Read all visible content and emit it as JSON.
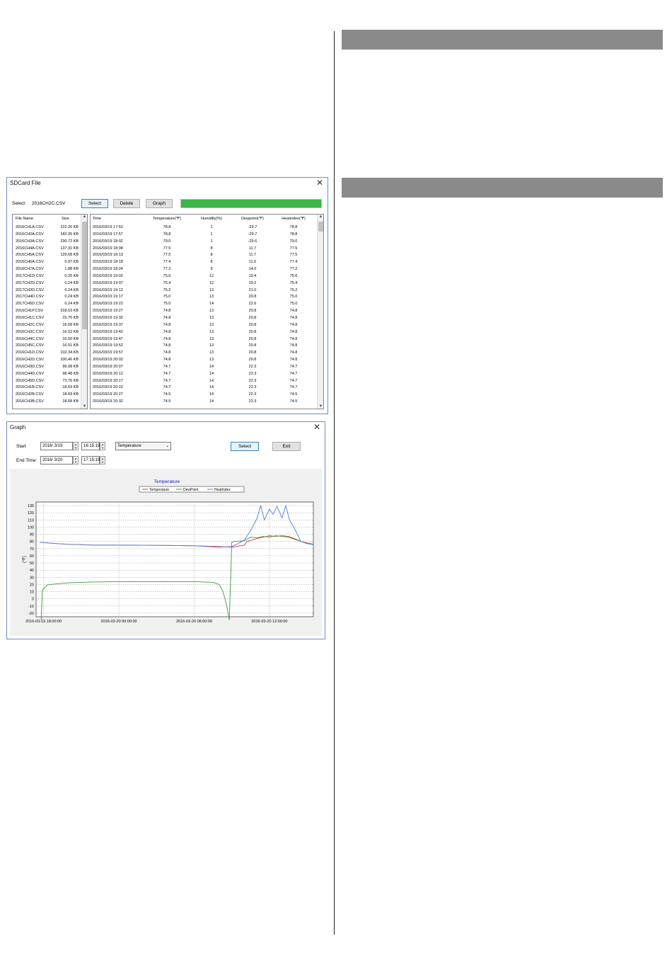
{
  "sdcard": {
    "title": "SDCard File",
    "select_label": "Select:",
    "selected_file": "2016CH2C.CSV",
    "buttons": {
      "select": "Select",
      "delete": "Delete",
      "graph": "Graph"
    },
    "progress": 1.0,
    "progress_color": "#3cb54a",
    "file_headers": [
      "File Name",
      "Size"
    ],
    "files": [
      [
        "2016CH1A.CSV",
        "222.26 KB"
      ],
      [
        "2016CH2A.CSV",
        "183.35 KB"
      ],
      [
        "2016CH3A.CSV",
        "230.72 KB"
      ],
      [
        "2016CH4A.CSV",
        "137.31 KB"
      ],
      [
        "2016CH5A.CSV",
        "129.68 KB"
      ],
      [
        "2016CH6A.CSV",
        "0.97 KB"
      ],
      [
        "2016CH7A.CSV",
        "1.88 KB"
      ],
      [
        "2017CH1D.CSV",
        "0.25 KB"
      ],
      [
        "2017CH2D.CSV",
        "0.24 KB"
      ],
      [
        "2017CH3D.CSV",
        "0.24 KB"
      ],
      [
        "2017CH4D.CSV",
        "0.24 KB"
      ],
      [
        "2017CH5D.CSV",
        "0.24 KB"
      ],
      [
        "2016CH1P.CSV",
        "318.53 KB"
      ],
      [
        "2016CH1C.CSV",
        "15.76 KB"
      ],
      [
        "2016CH2C.CSV",
        "16.58 KB"
      ],
      [
        "2016CH3C.CSV",
        "16.52 KB"
      ],
      [
        "2016CH4C.CSV",
        "16.50 KB"
      ],
      [
        "2016CH5C.CSV",
        "16.51 KB"
      ],
      [
        "2016CH1D.CSV",
        "102.34 KB"
      ],
      [
        "2016CH2D.CSV",
        "100.46 KB"
      ],
      [
        "2016CH3D.CSV",
        "99.08 KB"
      ],
      [
        "2016CH4D.CSV",
        "98.48 KB"
      ],
      [
        "2016CH5D.CSV",
        "73.76 KB"
      ],
      [
        "2016CH1B.CSV",
        "18.69 KB"
      ],
      [
        "2016CH2B.CSV",
        "18.69 KB"
      ],
      [
        "2016CH3B.CSV",
        "18.68 KB"
      ]
    ],
    "data_headers": [
      "Time",
      "Temperature(℉)",
      "Humidity(%)",
      "Dewpoint(℉)",
      "Heatindex(℉)"
    ],
    "rows": [
      [
        "2016/03/19 17:52",
        "78.8",
        "1",
        "-29.7",
        "78.8"
      ],
      [
        "2016/03/19 17:57",
        "78.8",
        "1",
        "-29.7",
        "78.8"
      ],
      [
        "2016/03/19 18:02",
        "79.0",
        "1",
        "-29.6",
        "79.0"
      ],
      [
        "2016/03/19 18:08",
        "77.5",
        "8",
        "11.7",
        "77.5"
      ],
      [
        "2016/03/19 18:13",
        "77.5",
        "8",
        "11.7",
        "77.5"
      ],
      [
        "2016/03/19 18:18",
        "77.4",
        "8",
        "11.5",
        "77.4"
      ],
      [
        "2016/03/19 18:24",
        "77.2",
        "9",
        "14.0",
        "77.2"
      ],
      [
        "2016/03/19 19:02",
        "75.6",
        "12",
        "19.4",
        "75.6"
      ],
      [
        "2016/03/19 19:07",
        "75.4",
        "12",
        "19.2",
        "75.4"
      ],
      [
        "2016/03/19 19:12",
        "75.2",
        "13",
        "21.0",
        "75.2"
      ],
      [
        "2016/03/19 19:17",
        "75.0",
        "13",
        "20.8",
        "75.0"
      ],
      [
        "2016/03/19 19:22",
        "75.0",
        "14",
        "22.6",
        "75.0"
      ],
      [
        "2016/03/19 19:27",
        "74.8",
        "13",
        "20.8",
        "74.8"
      ],
      [
        "2016/03/19 19:32",
        "74.8",
        "13",
        "20.8",
        "74.8"
      ],
      [
        "2016/03/19 19:37",
        "74.8",
        "13",
        "20.8",
        "74.8"
      ],
      [
        "2016/03/19 19:42",
        "74.8",
        "13",
        "20.8",
        "74.8"
      ],
      [
        "2016/03/19 19:47",
        "74.8",
        "13",
        "20.8",
        "74.8"
      ],
      [
        "2016/03/19 19:52",
        "74.8",
        "13",
        "20.8",
        "74.8"
      ],
      [
        "2016/03/19 19:57",
        "74.8",
        "13",
        "20.8",
        "74.8"
      ],
      [
        "2016/03/19 20:02",
        "74.8",
        "13",
        "20.8",
        "74.8"
      ],
      [
        "2016/03/19 20:07",
        "74.7",
        "14",
        "22.3",
        "74.7"
      ],
      [
        "2016/03/19 20:12",
        "74.7",
        "14",
        "22.3",
        "74.7"
      ],
      [
        "2016/03/19 20:17",
        "74.7",
        "14",
        "22.3",
        "74.7"
      ],
      [
        "2016/03/19 20:22",
        "74.7",
        "14",
        "22.3",
        "74.7"
      ],
      [
        "2016/03/19 20:27",
        "74.5",
        "14",
        "22.3",
        "74.5"
      ],
      [
        "2016/03/19 20:32",
        "74.5",
        "14",
        "22.3",
        "74.5"
      ]
    ]
  },
  "graph": {
    "title": "Graph",
    "start_label": "Start",
    "end_label": "End Time:",
    "start_date": "2016/ 3/19",
    "start_time": "16:15:19",
    "end_date": "2016/ 3/20",
    "end_time": "17:15:19",
    "combo_value": "Temperature",
    "buttons": {
      "select": "Select",
      "exit": "Exit"
    }
  },
  "chart_data": {
    "type": "line",
    "title": "Temperature",
    "ylabel": "(℉)",
    "xlabel": "",
    "ylim": [
      -25,
      135
    ],
    "yticks": [
      -20,
      -10,
      0,
      10,
      20,
      30,
      40,
      50,
      60,
      70,
      80,
      90,
      100,
      110,
      120,
      130
    ],
    "ytick_labels": [
      "-20",
      "-10",
      "0",
      "10",
      "20",
      "30",
      "40",
      "50",
      "60",
      "70",
      "80",
      "90",
      "100",
      "110",
      "120",
      "130"
    ],
    "x_hours_range": [
      -0.6,
      21.5
    ],
    "xticks": [
      0,
      6,
      12,
      18
    ],
    "xtick_labels": [
      "2016-03-19 18:00:00",
      "2016-03-20 00:00:00",
      "2016-03-20 06:00:00",
      "2016-03-20 12:00:00"
    ],
    "legend": [
      "Temperature",
      "DewPoint",
      "HeatIndex"
    ],
    "legend_position": "top-center",
    "grid": true,
    "series": [
      {
        "name": "Temperature",
        "color": "#d23a3a",
        "x": [
          -0.3,
          1,
          2,
          3,
          4,
          6,
          8,
          10,
          12,
          14,
          15,
          16,
          16.2,
          17,
          17.5,
          18,
          18.5,
          19,
          19.5,
          20,
          20.5,
          21,
          21.5
        ],
        "y": [
          78.8,
          77,
          76,
          75.5,
          75,
          75,
          74.8,
          74.5,
          74,
          73,
          72,
          75,
          80,
          84,
          86,
          88,
          87,
          88,
          87,
          84,
          80,
          78,
          76
        ]
      },
      {
        "name": "DewPoint",
        "color": "#3f9a3f",
        "x": [
          -0.2,
          -0.1,
          0,
          0.3,
          1,
          2,
          3,
          4,
          6,
          8,
          10,
          12,
          13.5,
          14,
          14.3,
          14.6,
          14.8,
          15,
          15.2,
          16,
          16.5,
          17,
          17.5,
          18,
          18.5,
          19,
          19.5,
          20,
          20.5,
          21,
          21.5
        ],
        "y": [
          -29.7,
          11.7,
          14,
          19.4,
          20.8,
          22.3,
          23,
          23.5,
          24,
          24,
          24,
          24,
          23,
          20,
          10,
          -10,
          -29.5,
          79,
          80,
          81,
          86,
          85,
          87,
          86,
          88,
          87,
          86,
          83,
          80,
          77,
          75.5
        ]
      },
      {
        "name": "HeatIndex",
        "color": "#4f7fd8",
        "x": [
          -0.3,
          1,
          2,
          3,
          4,
          6,
          8,
          10,
          12,
          14,
          15,
          15.5,
          16,
          16.5,
          17,
          17.3,
          17.6,
          18,
          18.3,
          18.6,
          19,
          19.3,
          19.6,
          20,
          20.5,
          21,
          21.5
        ],
        "y": [
          78.8,
          77,
          76,
          75.5,
          75,
          75,
          74.8,
          74.5,
          74,
          72,
          73,
          77,
          82,
          95,
          112,
          130,
          110,
          125,
          118,
          129,
          113,
          130,
          110,
          98,
          80,
          77,
          76
        ]
      }
    ]
  }
}
